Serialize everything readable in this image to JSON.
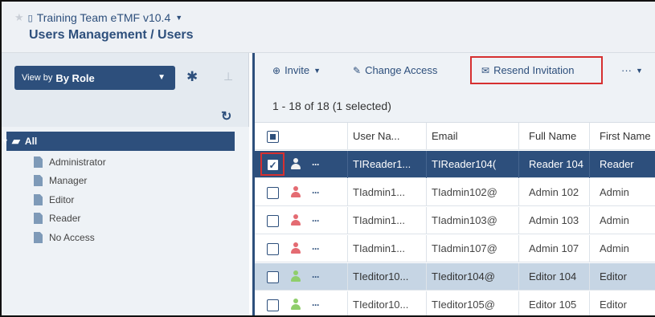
{
  "header": {
    "project": "Training Team eTMF v10.4",
    "breadcrumb": "Users Management / Users"
  },
  "sidebar": {
    "view_by_prefix": "View by",
    "view_by_value": "By Role",
    "tree_root": "All",
    "roles": [
      "Administrator",
      "Manager",
      "Editor",
      "Reader",
      "No Access"
    ]
  },
  "toolbar": {
    "invite": "Invite",
    "change_access": "Change Access",
    "resend_invitation": "Resend Invitation",
    "more": "···"
  },
  "status": {
    "count_text": "1 - 18 of 18 (1 selected)"
  },
  "table": {
    "columns": [
      "User Na...",
      "Email",
      "Full Name",
      "First Name"
    ],
    "rows": [
      {
        "user": "TIReader1...",
        "email": "TIReader104(",
        "full_name": "Reader 104",
        "first_name": "Reader",
        "role_color": "#f0f0f0",
        "state": "selected"
      },
      {
        "user": "TIadmin1...",
        "email": "TIadmin102@",
        "full_name": "Admin 102",
        "first_name": "Admin",
        "role_color": "#e46b72",
        "state": "normal"
      },
      {
        "user": "TIadmin1...",
        "email": "TIadmin103@",
        "full_name": "Admin 103",
        "first_name": "Admin",
        "role_color": "#e46b72",
        "state": "normal"
      },
      {
        "user": "TIadmin1...",
        "email": "TIadmin107@",
        "full_name": "Admin 107",
        "first_name": "Admin",
        "role_color": "#e46b72",
        "state": "normal"
      },
      {
        "user": "TIeditor10...",
        "email": "TIeditor104@",
        "full_name": "Editor 104",
        "first_name": "Editor",
        "role_color": "#8fce6b",
        "state": "hover"
      },
      {
        "user": "TIeditor10...",
        "email": "TIeditor105@",
        "full_name": "Editor 105",
        "first_name": "Editor",
        "role_color": "#8fce6b",
        "state": "normal"
      }
    ]
  },
  "colors": {
    "brand": "#2d4f7c",
    "highlight_box": "#d63030",
    "row_hover": "#c6d5e4"
  }
}
